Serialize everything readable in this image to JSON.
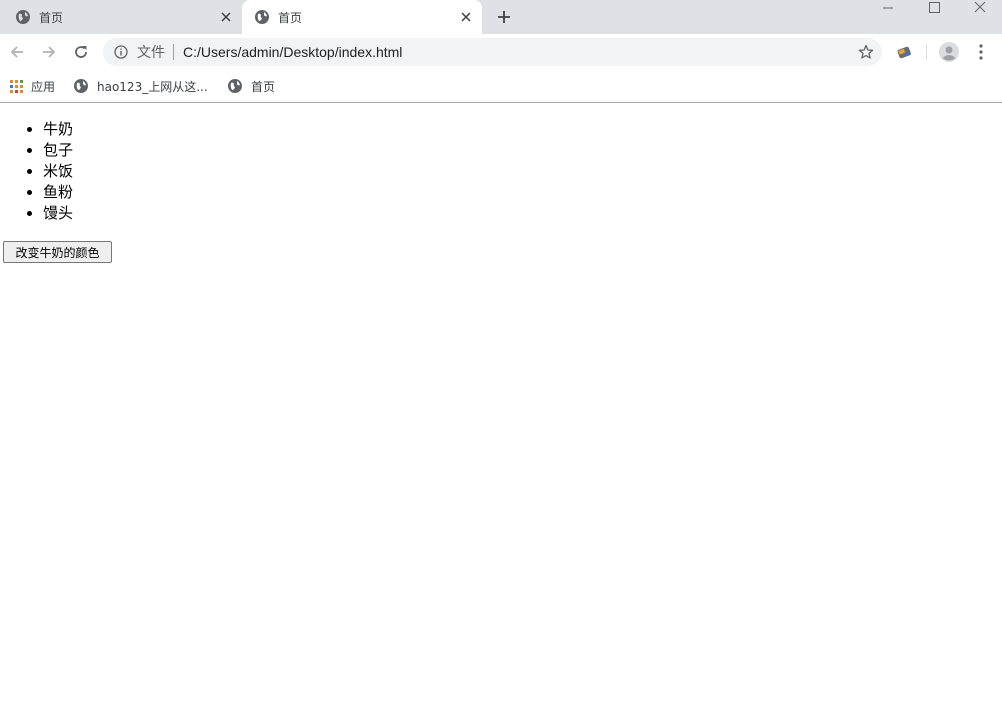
{
  "tabs": [
    {
      "title": "首页",
      "active": false
    },
    {
      "title": "首页",
      "active": true
    }
  ],
  "toolbar": {
    "chip": "文件",
    "url": "C:/Users/admin/Desktop/index.html"
  },
  "bookmarks": {
    "apps_label": "应用",
    "items": [
      {
        "label": "hao123_上网从这..."
      },
      {
        "label": "首页"
      }
    ]
  },
  "page": {
    "list_items": [
      "牛奶",
      "包子",
      "米饭",
      "鱼粉",
      "馒头"
    ],
    "button_label": "改变牛奶的颜色"
  },
  "icons": {
    "globe": "globe-icon",
    "close": "close-icon",
    "new_tab": "plus-icon",
    "back": "back-arrow-icon",
    "forward": "forward-arrow-icon",
    "reload": "reload-icon",
    "info": "info-icon",
    "star": "star-icon",
    "extension": "extension-icon",
    "profile": "profile-avatar-icon",
    "menu": "kebab-menu-icon",
    "apps": "apps-grid-icon"
  },
  "colors": {
    "tabstrip": "#dee1e6",
    "omnibox": "#f1f3f4",
    "apps_dots": "#e0892f"
  }
}
